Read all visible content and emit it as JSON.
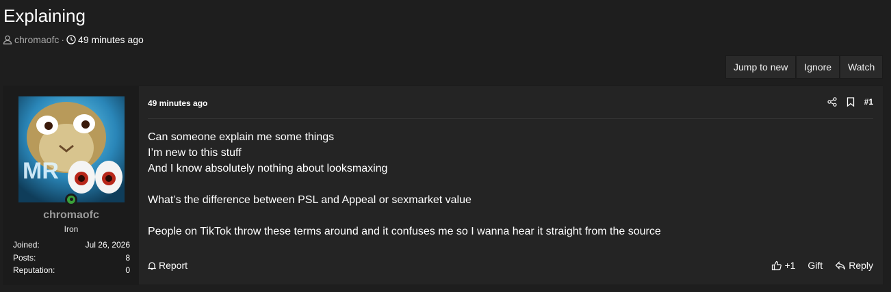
{
  "thread": {
    "title": "Explaining",
    "author": "chromaofc",
    "separator": "·",
    "time": "49 minutes ago"
  },
  "actions": {
    "jump_to_new": "Jump to new",
    "ignore": "Ignore",
    "watch": "Watch"
  },
  "post": {
    "user": {
      "name": "chromaofc",
      "rank": "Iron",
      "stats": [
        {
          "label": "Joined:",
          "value": "Jul 26, 2026"
        },
        {
          "label": "Posts:",
          "value": "8"
        },
        {
          "label": "Reputation:",
          "value": "0"
        }
      ],
      "online": true
    },
    "date": "49 minutes ago",
    "number": "#1",
    "body": [
      "Can someone explain me some things",
      "I’m new to this stuff",
      "And I know absolutely nothing about looksmaxing",
      "",
      "What’s the difference between PSL and Appeal or sexmarket value",
      "",
      "People on TikTok throw these terms around and it confuses me so I wanna hear it straight from the source"
    ],
    "footer": {
      "report": "Report",
      "like": "+1",
      "gift": "Gift",
      "reply": "Reply"
    }
  },
  "icons": {
    "user": "user-icon",
    "clock": "clock-icon",
    "share": "share-icon",
    "bookmark": "bookmark-icon",
    "bell": "bell-icon",
    "thumbs_up": "thumbs-up-icon",
    "reply": "reply-icon"
  },
  "colors": {
    "background": "#1e1e1e",
    "panel": "#242424",
    "user_panel": "#1b1b1b",
    "online": "#3aa13a",
    "muted_text": "#a8a8a8"
  }
}
